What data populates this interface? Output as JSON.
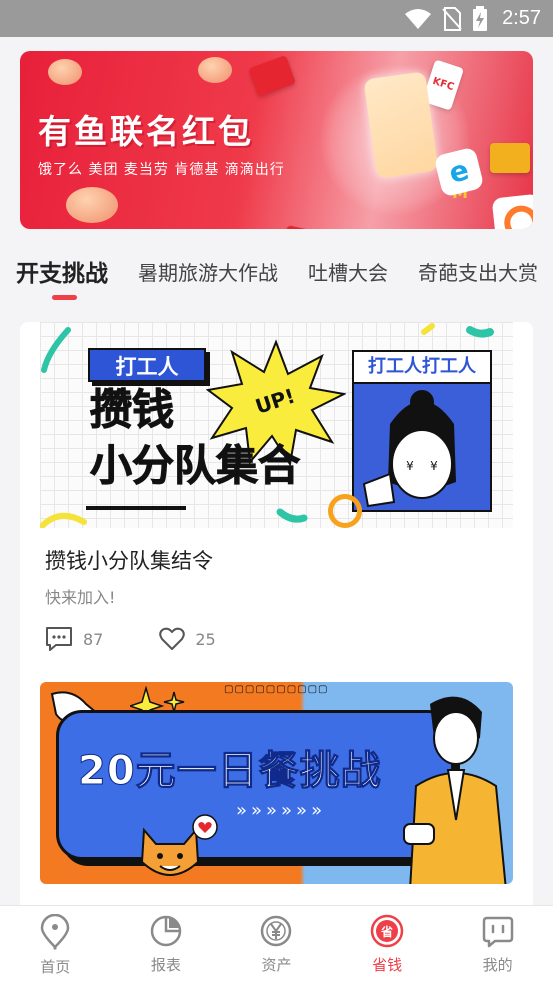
{
  "status_bar": {
    "time": "2:57",
    "icons": [
      "wifi-icon",
      "no-sim-icon",
      "battery-charging-icon"
    ]
  },
  "banner": {
    "title": "有鱼联名红包",
    "brands": "饿了么 美团 麦当劳 肯德基 滴滴出行",
    "logos": [
      "KFC",
      "M",
      "e"
    ]
  },
  "tabs": [
    {
      "label": "开支挑战",
      "active": true
    },
    {
      "label": "暑期旅游大作战",
      "active": false
    },
    {
      "label": "吐槽大会",
      "active": false
    },
    {
      "label": "奇葩支出大赏",
      "active": false
    }
  ],
  "posts": [
    {
      "title": "攒钱小分队集结令",
      "subtitle": "快来加入!",
      "comments": "87",
      "likes": "25",
      "poster": {
        "tag": "打工人",
        "line1": "攒钱",
        "line2": "小分队集合",
        "burst": "UP!",
        "side_head": "打工人打工人"
      }
    },
    {
      "poster": {
        "title": "20元一日餐挑战",
        "arrows": "»»»»»»"
      }
    }
  ],
  "bottom_nav": [
    {
      "label": "首页",
      "icon": "location-pin-icon",
      "active": false
    },
    {
      "label": "报表",
      "icon": "pie-chart-icon",
      "active": false
    },
    {
      "label": "资产",
      "icon": "yuan-coin-icon",
      "active": false
    },
    {
      "label": "省钱",
      "icon": "save-money-icon",
      "active": true
    },
    {
      "label": "我的",
      "icon": "profile-face-icon",
      "active": false
    }
  ],
  "colors": {
    "accent": "#ef3f48",
    "banner_red": "#e8203a",
    "poster_blue": "#2d55d6",
    "poster_orange": "#f47a22"
  }
}
